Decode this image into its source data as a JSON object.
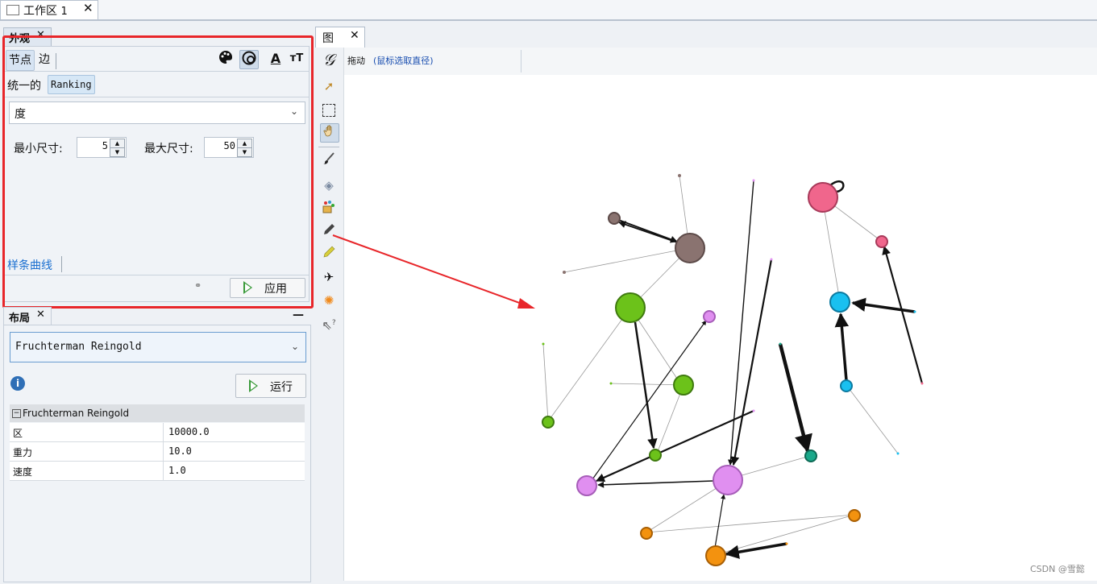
{
  "workspace_tab": {
    "label": "工作区",
    "index": "1",
    "close": "✕"
  },
  "appearance": {
    "tab_title": "外观",
    "tab_close": "✕",
    "modes": {
      "nodes": "节点",
      "edges": "边"
    },
    "tool_icons": {
      "color": "palette-icon",
      "size": "size-rings-icon",
      "label_color": "A",
      "label_size": "тT"
    },
    "sub_tabs": {
      "unique": "统一的",
      "ranking": "Ranking"
    },
    "attribute_select": "度",
    "min_size_label": "最小尺寸:",
    "min_size_value": "5",
    "max_size_label": "最大尺寸:",
    "max_size_value": "50",
    "spline_link": "样条曲线",
    "apply_button": "应用",
    "accent_color": "#1a6fd0",
    "highlight_color": "#e8262a"
  },
  "layout": {
    "tab_title": "布局",
    "tab_close": "✕",
    "minimize": "—",
    "algorithm": "Fruchterman Reingold",
    "run_button": "运行",
    "properties_header": "Fruchterman Reingold",
    "properties": [
      {
        "key": "区",
        "value": "10000.0"
      },
      {
        "key": "重力",
        "value": "10.0"
      },
      {
        "key": "速度",
        "value": "1.0"
      }
    ]
  },
  "graph": {
    "tab_title": "图",
    "tab_close": "✕",
    "drag_label": "拖动",
    "drag_hint": "(鼠标选取直径)",
    "tools": [
      "gephi-logo-icon",
      "pointer-icon",
      "rectangle-select-icon",
      "drag-hand-icon",
      "brush-icon",
      "diamond-icon",
      "color-bucket-icon",
      "pencil-icon",
      "edge-pencil-icon",
      "airplane-icon",
      "sun-icon",
      "help-pointer-icon"
    ]
  },
  "watermark": "CSDN @雪懿"
}
